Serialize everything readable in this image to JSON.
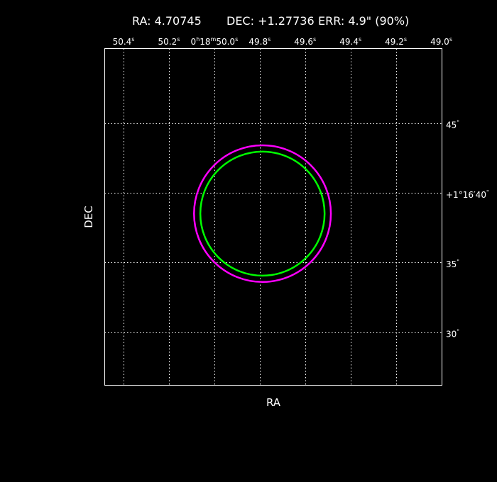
{
  "header": {
    "ra_text": "RA: 4.70745",
    "dec_text": "DEC: +1.27736",
    "err_text": "ERR: 4.9\" (90%)"
  },
  "chart_data": {
    "type": "scatter",
    "xlabel": "RA",
    "ylabel": "DEC",
    "grid": true,
    "xlim": [
      50.483,
      48.997
    ],
    "ylim": [
      26.19,
      50.34
    ],
    "x_ticks": [
      {
        "value": 50.4,
        "label": "50.4",
        "sup": "s"
      },
      {
        "value": 50.2,
        "label": "50.2",
        "sup": "s"
      },
      {
        "value": 50.0,
        "label": "0",
        "sup": "h",
        "label2": "18",
        "sup2": "m",
        "label3": "50.0",
        "sup3": "s"
      },
      {
        "value": 49.8,
        "label": "49.8",
        "sup": "s"
      },
      {
        "value": 49.6,
        "label": "49.6",
        "sup": "s"
      },
      {
        "value": 49.4,
        "label": "49.4",
        "sup": "s"
      },
      {
        "value": 49.2,
        "label": "49.2",
        "sup": "s"
      },
      {
        "value": 49.0,
        "label": "49.0",
        "sup": "s"
      }
    ],
    "y_ticks": [
      {
        "value": 45,
        "label": "45",
        "sup": "\""
      },
      {
        "value": 40,
        "label": "+1°16′40",
        "sup": "\""
      },
      {
        "value": 35,
        "label": "35",
        "sup": "\""
      },
      {
        "value": 30,
        "label": "30",
        "sup": "\""
      }
    ],
    "circles": [
      {
        "name": "magenta-error-circle",
        "color": "#ff00ff",
        "ra_sec": 49.788,
        "dec_arcsec": 38.5,
        "radius_arcsec": 4.9
      },
      {
        "name": "green-error-circle",
        "color": "#00ff00",
        "ra_sec": 49.788,
        "dec_arcsec": 38.5,
        "radius_arcsec": 4.45
      }
    ]
  }
}
